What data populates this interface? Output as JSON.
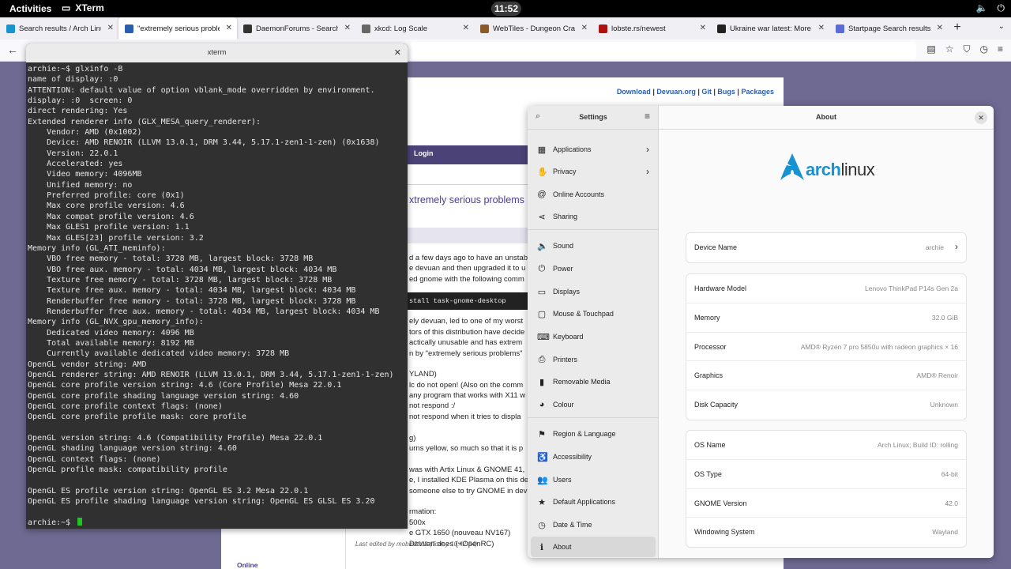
{
  "topbar": {
    "activities": "Activities",
    "app_name": "XTerm",
    "clock": "11:52"
  },
  "browser": {
    "tabs": [
      {
        "title": "Search results / Arch Linux F",
        "color": "#1793d1"
      },
      {
        "title": "\"extremely serious problems",
        "color": "#2a5db0"
      },
      {
        "title": "DaemonForums - Search Re",
        "color": "#333333"
      },
      {
        "title": "xkcd: Log Scale",
        "color": "#666666"
      },
      {
        "title": "WebTiles - Dungeon Crawl S",
        "color": "#8a5a2b"
      },
      {
        "title": "lobste.rs/newest",
        "color": "#ac130d"
      },
      {
        "title": "Ukraine war latest: More evi",
        "color": "#222222"
      },
      {
        "title": "Startpage Search results",
        "color": "#5a6bd8"
      }
    ]
  },
  "forum": {
    "links": [
      "Download",
      "Devuan.org",
      "Git",
      "Bugs",
      "Packages"
    ],
    "login": "Login",
    "post_title": "xtremely serious problems",
    "post_lines": [
      "d a few days ago to have an unstab",
      "e devuan and then upgraded it to u",
      "ed gnome with the following comm",
      "",
      "",
      "",
      "ely devuan, led to one of my worst",
      "tors of this distribution have decide",
      "actically unusable and has extrem",
      "n by \"extremely serious problems\"",
      "",
      "YLAND)",
      "lc do not open! (Also on the comm",
      "any program that works with X11 w",
      "not respond :/",
      "not respond when it tries to displa",
      "",
      "g)",
      "urns yellow, so much so that it is p",
      "",
      "was with Artix Linux & GNOME 41,",
      "e, I installed KDE Plasma on this de",
      "someone else to try GNOME in dev",
      "",
      "rmation:",
      "500x",
      "e GTX 1650 (nouveau NV167)",
      "Devuan does (+OpenRC)"
    ],
    "code": "stall task-gnome-desktop",
    "edited": "Last edited by mobin2008 (Today 10:42:54)",
    "online": "Online"
  },
  "xterm": {
    "title": "xterm",
    "lines": [
      "archie:~$ glxinfo -B",
      "name of display: :0",
      "ATTENTION: default value of option vblank_mode overridden by environment.",
      "display: :0  screen: 0",
      "direct rendering: Yes",
      "Extended renderer info (GLX_MESA_query_renderer):",
      "    Vendor: AMD (0x1002)",
      "    Device: AMD RENOIR (LLVM 13.0.1, DRM 3.44, 5.17.1-zen1-1-zen) (0x1638)",
      "    Version: 22.0.1",
      "    Accelerated: yes",
      "    Video memory: 4096MB",
      "    Unified memory: no",
      "    Preferred profile: core (0x1)",
      "    Max core profile version: 4.6",
      "    Max compat profile version: 4.6",
      "    Max GLES1 profile version: 1.1",
      "    Max GLES[23] profile version: 3.2",
      "Memory info (GL_ATI_meminfo):",
      "    VBO free memory - total: 3728 MB, largest block: 3728 MB",
      "    VBO free aux. memory - total: 4034 MB, largest block: 4034 MB",
      "    Texture free memory - total: 3728 MB, largest block: 3728 MB",
      "    Texture free aux. memory - total: 4034 MB, largest block: 4034 MB",
      "    Renderbuffer free memory - total: 3728 MB, largest block: 3728 MB",
      "    Renderbuffer free aux. memory - total: 4034 MB, largest block: 4034 MB",
      "Memory info (GL_NVX_gpu_memory_info):",
      "    Dedicated video memory: 4096 MB",
      "    Total available memory: 8192 MB",
      "    Currently available dedicated video memory: 3728 MB",
      "OpenGL vendor string: AMD",
      "OpenGL renderer string: AMD RENOIR (LLVM 13.0.1, DRM 3.44, 5.17.1-zen1-1-zen)",
      "OpenGL core profile version string: 4.6 (Core Profile) Mesa 22.0.1",
      "OpenGL core profile shading language version string: 4.60",
      "OpenGL core profile context flags: (none)",
      "OpenGL core profile profile mask: core profile",
      "",
      "OpenGL version string: 4.6 (Compatibility Profile) Mesa 22.0.1",
      "OpenGL shading language version string: 4.60",
      "OpenGL context flags: (none)",
      "OpenGL profile mask: compatibility profile",
      "",
      "OpenGL ES profile version string: OpenGL ES 3.2 Mesa 22.0.1",
      "OpenGL ES profile shading language version string: OpenGL ES GLSL ES 3.20",
      "",
      "archie:~$ "
    ],
    "cursor_color": "#25c225"
  },
  "settings": {
    "sidebar_title": "Settings",
    "main_title": "About",
    "logo_text": "arch",
    "logo_text_2": "linux",
    "items": [
      {
        "label": "Applications",
        "icon": "apps-icon",
        "glyph": "▦",
        "chevron": true
      },
      {
        "label": "Privacy",
        "icon": "privacy-icon",
        "glyph": "✋",
        "chevron": true
      },
      {
        "label": "Online Accounts",
        "icon": "at-icon",
        "glyph": "@",
        "chevron": false
      },
      {
        "label": "Sharing",
        "icon": "share-icon",
        "glyph": "⋖",
        "chevron": false
      },
      {
        "label": "Sound",
        "icon": "speaker-icon",
        "glyph": "🔈",
        "chevron": false
      },
      {
        "label": "Power",
        "icon": "power-icon",
        "glyph": "⏻",
        "chevron": false
      },
      {
        "label": "Displays",
        "icon": "display-icon",
        "glyph": "▭",
        "chevron": false
      },
      {
        "label": "Mouse & Touchpad",
        "icon": "mouse-icon",
        "glyph": "▢",
        "chevron": false
      },
      {
        "label": "Keyboard",
        "icon": "keyboard-icon",
        "glyph": "⌨",
        "chevron": false
      },
      {
        "label": "Printers",
        "icon": "printer-icon",
        "glyph": "⎙",
        "chevron": false
      },
      {
        "label": "Removable Media",
        "icon": "usb-icon",
        "glyph": "▮",
        "chevron": false
      },
      {
        "label": "Colour",
        "icon": "colour-icon",
        "glyph": "◕",
        "chevron": false
      },
      {
        "label": "Region & Language",
        "icon": "flag-icon",
        "glyph": "⚑",
        "chevron": false
      },
      {
        "label": "Accessibility",
        "icon": "accessibility-icon",
        "glyph": "♿",
        "chevron": false
      },
      {
        "label": "Users",
        "icon": "users-icon",
        "glyph": "👥",
        "chevron": false
      },
      {
        "label": "Default Applications",
        "icon": "star-icon",
        "glyph": "★",
        "chevron": false
      },
      {
        "label": "Date & Time",
        "icon": "clock-icon",
        "glyph": "◷",
        "chevron": false
      },
      {
        "label": "About",
        "icon": "info-icon",
        "glyph": "ℹ",
        "chevron": false
      }
    ],
    "device": {
      "label": "Device Name",
      "value": "archie"
    },
    "hardware": [
      {
        "label": "Hardware Model",
        "value": "Lenovo ThinkPad P14s Gen 2a"
      },
      {
        "label": "Memory",
        "value": "32.0 GiB"
      },
      {
        "label": "Processor",
        "value": "AMD® Ryzen 7 pro 5850u with radeon graphics × 16"
      },
      {
        "label": "Graphics",
        "value": "AMD® Renoir"
      },
      {
        "label": "Disk Capacity",
        "value": "Unknown"
      }
    ],
    "os": [
      {
        "label": "OS Name",
        "value": "Arch Linux; Build ID: rolling"
      },
      {
        "label": "OS Type",
        "value": "64-bit"
      },
      {
        "label": "GNOME Version",
        "value": "42.0"
      },
      {
        "label": "Windowing System",
        "value": "Wayland"
      }
    ]
  }
}
